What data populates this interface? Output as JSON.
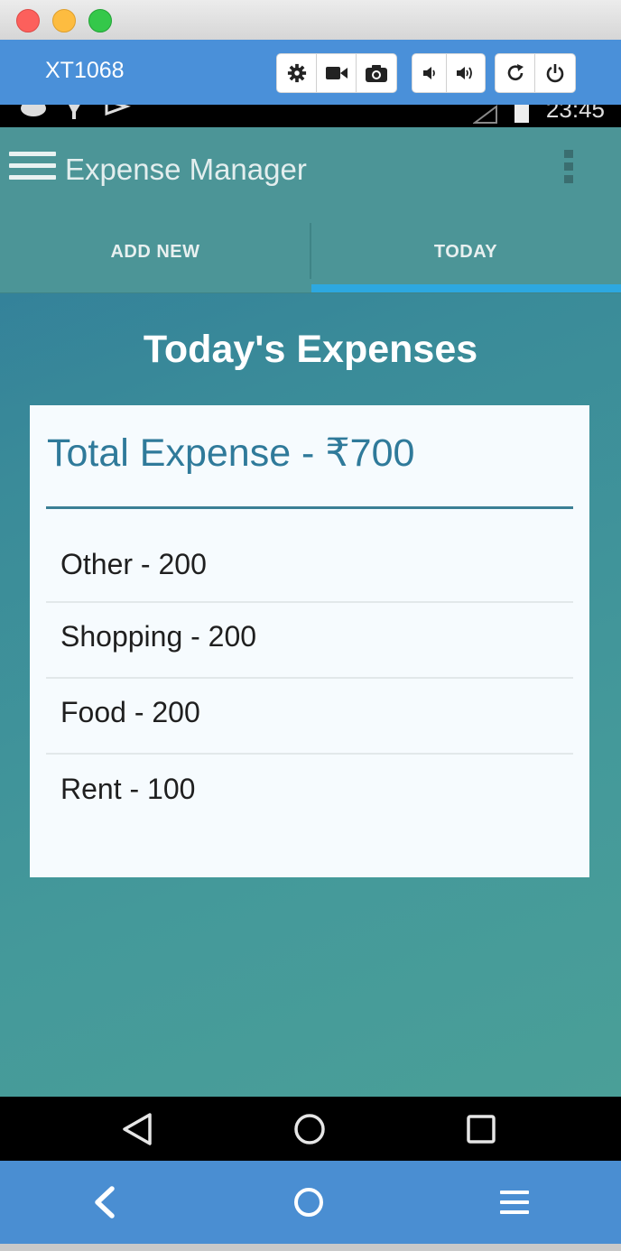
{
  "window": {
    "device_name": "XT1068"
  },
  "toolbar": {
    "icons": [
      "gear-icon",
      "video-camera-icon",
      "camera-icon",
      "volume-down-icon",
      "volume-up-icon",
      "rotate-icon",
      "power-icon"
    ]
  },
  "statusbar": {
    "time": "23:45"
  },
  "app": {
    "title": "Expense Manager",
    "tabs": [
      {
        "label": "ADD NEW",
        "selected": false
      },
      {
        "label": "TODAY",
        "selected": true
      }
    ],
    "heading": "Today's Expenses",
    "total_label": "Total Expense - ₹700",
    "expenses": [
      {
        "label": "Other - 200"
      },
      {
        "label": "Shopping - 200"
      },
      {
        "label": "Food - 200"
      },
      {
        "label": "Rent - 100"
      }
    ],
    "colors": {
      "accent": "#2da8e0",
      "appbar": "#4c9597",
      "card_title": "#2f7a9a"
    }
  },
  "android_nav": [
    "back-triangle-icon",
    "home-circle-icon",
    "recents-square-icon"
  ],
  "host_controls": [
    "chevron-left-icon",
    "home-circle-icon",
    "menu-icon"
  ]
}
